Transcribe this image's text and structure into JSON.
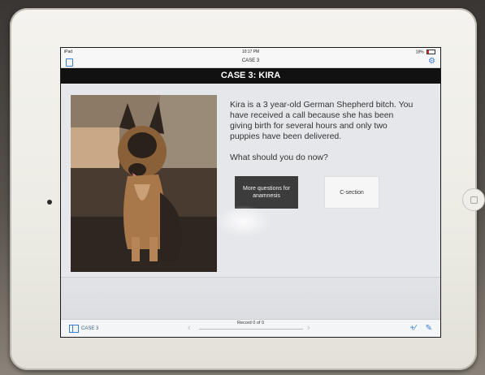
{
  "status_bar": {
    "device": "iPad",
    "time": "10:17 PM",
    "battery": "18%"
  },
  "nav": {
    "title": "CASE 3"
  },
  "case_title": "CASE 3: KIRA",
  "description": "Kira is a 3 year-old German Shepherd bitch. You have received a call because she has been giving birth for several hours and only two puppies have been delivered.",
  "question": "What should you do now?",
  "options": {
    "anamnesis": "More questions for anamnesis",
    "csection": "C-section"
  },
  "toolbar": {
    "case_label": "CASE 3",
    "record_label": "Record 0 of 0"
  },
  "icons": {
    "pages": "pages-icon",
    "settings": "gear-icon",
    "prev": "chevron-left-icon",
    "next": "chevron-right-icon",
    "add": "add-record-icon",
    "edit": "edit-icon"
  },
  "colors": {
    "accent": "#3a7bd5",
    "title_band": "#111111",
    "option_dark": "#3c3c3c"
  }
}
